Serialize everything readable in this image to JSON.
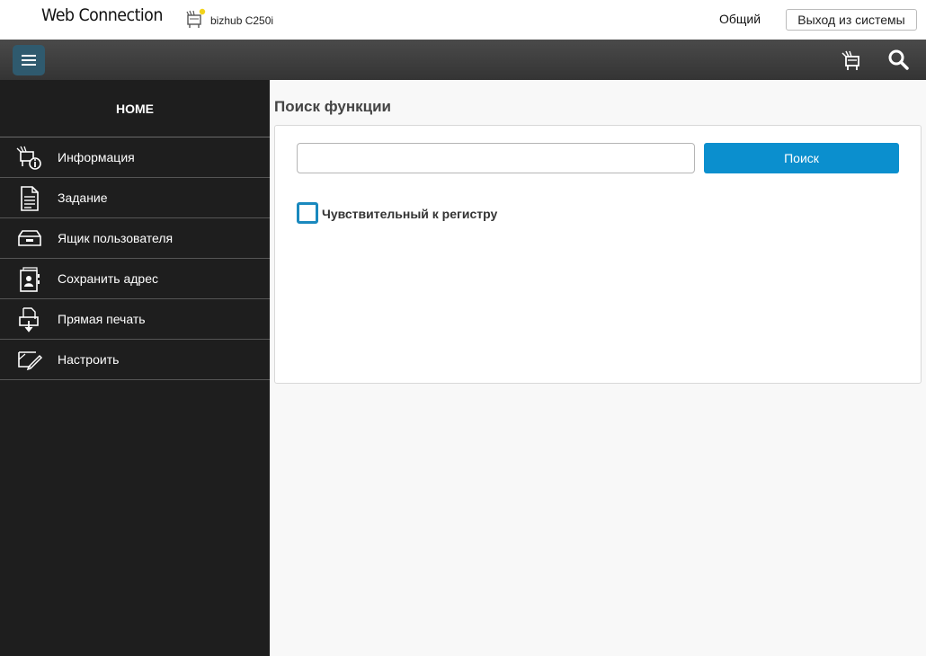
{
  "header": {
    "brand": "Web Connection",
    "model_name": "bizhub C250i",
    "user_mode": "Общий",
    "logout_label": "Выход из системы"
  },
  "toolbar": {
    "menu_icon": "hamburger-icon",
    "right_icons": [
      "printer-status-icon",
      "search-icon"
    ]
  },
  "sidebar": {
    "home_label": "HOME",
    "items": [
      {
        "label": "Информация",
        "icon": "printer-info-icon"
      },
      {
        "label": "Задание",
        "icon": "document-icon"
      },
      {
        "label": "Ящик пользователя",
        "icon": "box-tray-icon"
      },
      {
        "label": "Сохранить адрес",
        "icon": "address-book-icon"
      },
      {
        "label": "Прямая печать",
        "icon": "direct-print-icon"
      },
      {
        "label": "Настроить",
        "icon": "customize-icon"
      }
    ]
  },
  "main": {
    "title": "Поиск функции",
    "search_value": "",
    "search_button": "Поиск",
    "case_sensitive_label": "Чувствительный к регистру",
    "case_sensitive_checked": false
  },
  "colors": {
    "accent_blue": "#0b8fce",
    "sidebar_bg": "#1e1e1e",
    "toolbar_bg": "#3c3c3c",
    "menu_button_bg": "#2f5a6e"
  }
}
